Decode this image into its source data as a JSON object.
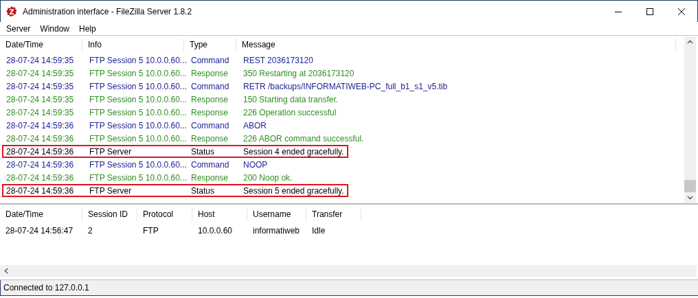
{
  "window": {
    "title": "Administration interface - FileZilla Server 1.8.2"
  },
  "menu": [
    "Server",
    "Window",
    "Help"
  ],
  "log": {
    "columns": [
      "Date/Time",
      "Info",
      "Type",
      "Message"
    ],
    "rows": [
      {
        "kind": "command",
        "highlighted": false,
        "cells": [
          "28-07-24 14:59:35",
          "FTP Session 5 10.0.0.60...",
          "Command",
          "REST 2036173120"
        ]
      },
      {
        "kind": "response",
        "highlighted": false,
        "cells": [
          "28-07-24 14:59:35",
          "FTP Session 5 10.0.0.60...",
          "Response",
          "350 Restarting at 2036173120"
        ]
      },
      {
        "kind": "command",
        "highlighted": false,
        "cells": [
          "28-07-24 14:59:35",
          "FTP Session 5 10.0.0.60...",
          "Command",
          "RETR /backups/INFORMATIWEB-PC_full_b1_s1_v5.tib"
        ]
      },
      {
        "kind": "response",
        "highlighted": false,
        "cells": [
          "28-07-24 14:59:35",
          "FTP Session 5 10.0.0.60...",
          "Response",
          "150 Starting data transfer."
        ]
      },
      {
        "kind": "response",
        "highlighted": false,
        "cells": [
          "28-07-24 14:59:35",
          "FTP Session 5 10.0.0.60...",
          "Response",
          "226 Operation successful"
        ]
      },
      {
        "kind": "command",
        "highlighted": false,
        "cells": [
          "28-07-24 14:59:36",
          "FTP Session 5 10.0.0.60...",
          "Command",
          "ABOR"
        ]
      },
      {
        "kind": "response",
        "highlighted": false,
        "cells": [
          "28-07-24 14:59:36",
          "FTP Session 5 10.0.0.60...",
          "Response",
          "226 ABOR command successful."
        ]
      },
      {
        "kind": "status",
        "highlighted": true,
        "cells": [
          "28-07-24 14:59:36",
          "FTP Server",
          "Status",
          "Session 4 ended gracefully."
        ]
      },
      {
        "kind": "command",
        "highlighted": false,
        "cells": [
          "28-07-24 14:59:36",
          "FTP Session 5 10.0.0.60...",
          "Command",
          "NOOP"
        ]
      },
      {
        "kind": "response",
        "highlighted": false,
        "cells": [
          "28-07-24 14:59:36",
          "FTP Session 5 10.0.0.60...",
          "Response",
          "200 Noop ok."
        ]
      },
      {
        "kind": "status",
        "highlighted": true,
        "cells": [
          "28-07-24 14:59:36",
          "FTP Server",
          "Status",
          "Session 5 ended gracefully."
        ]
      }
    ]
  },
  "sessions": {
    "columns": [
      "Date/Time",
      "Session ID",
      "Protocol",
      "Host",
      "Username",
      "Transfer"
    ],
    "rows": [
      [
        "28-07-24 14:56:47",
        "2",
        "FTP",
        "10.0.0.60",
        "informatiweb",
        "Idle"
      ]
    ]
  },
  "status_bar": "Connected to 127.0.0.1"
}
